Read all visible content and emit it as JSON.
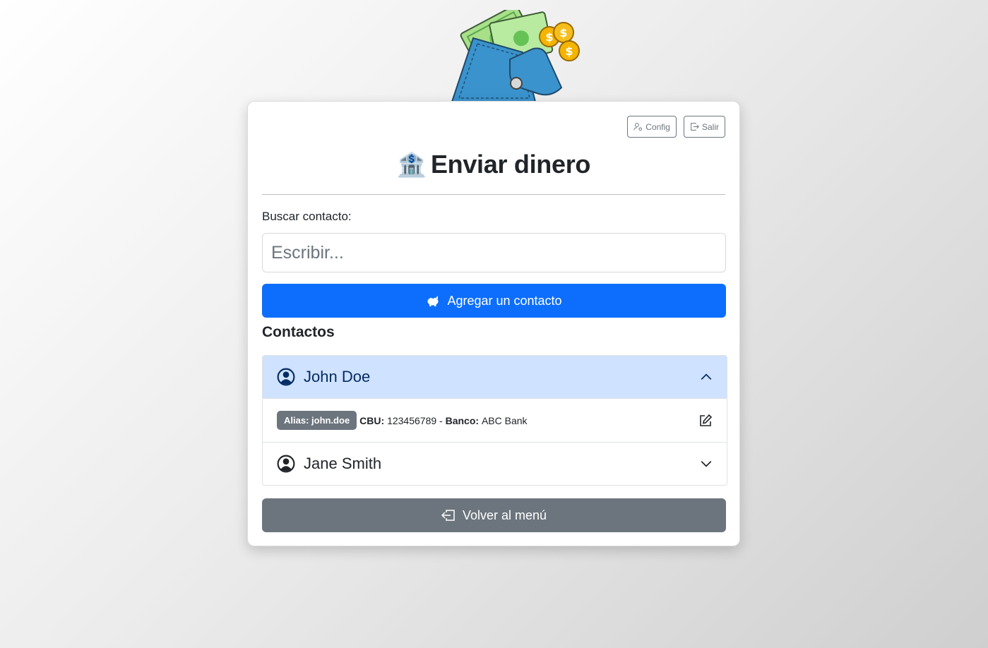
{
  "header": {
    "config_label": "Config",
    "logout_label": "Salir",
    "title_icon": "🏦",
    "title": "Enviar dinero"
  },
  "search": {
    "label": "Buscar contacto:",
    "placeholder": "Escribir...",
    "value": ""
  },
  "add_contact": {
    "label": "Agregar un contacto",
    "icon": "piggy-bank-icon"
  },
  "contacts": {
    "title": "Contactos",
    "items": [
      {
        "name": "John Doe",
        "expanded": true,
        "alias_badge": "Alias: john.doe",
        "cbu_label": "CBU:",
        "cbu": "123456789",
        "separator": "-",
        "bank_label": "Banco:",
        "bank": "ABC Bank"
      },
      {
        "name": "Jane Smith",
        "expanded": false
      }
    ]
  },
  "back_button": {
    "label": "Volver al menú",
    "icon": "box-arrow-in-left-icon"
  },
  "colors": {
    "primary": "#0d6efd",
    "secondary": "#6c757d",
    "accordion_active": "#cfe2ff"
  }
}
